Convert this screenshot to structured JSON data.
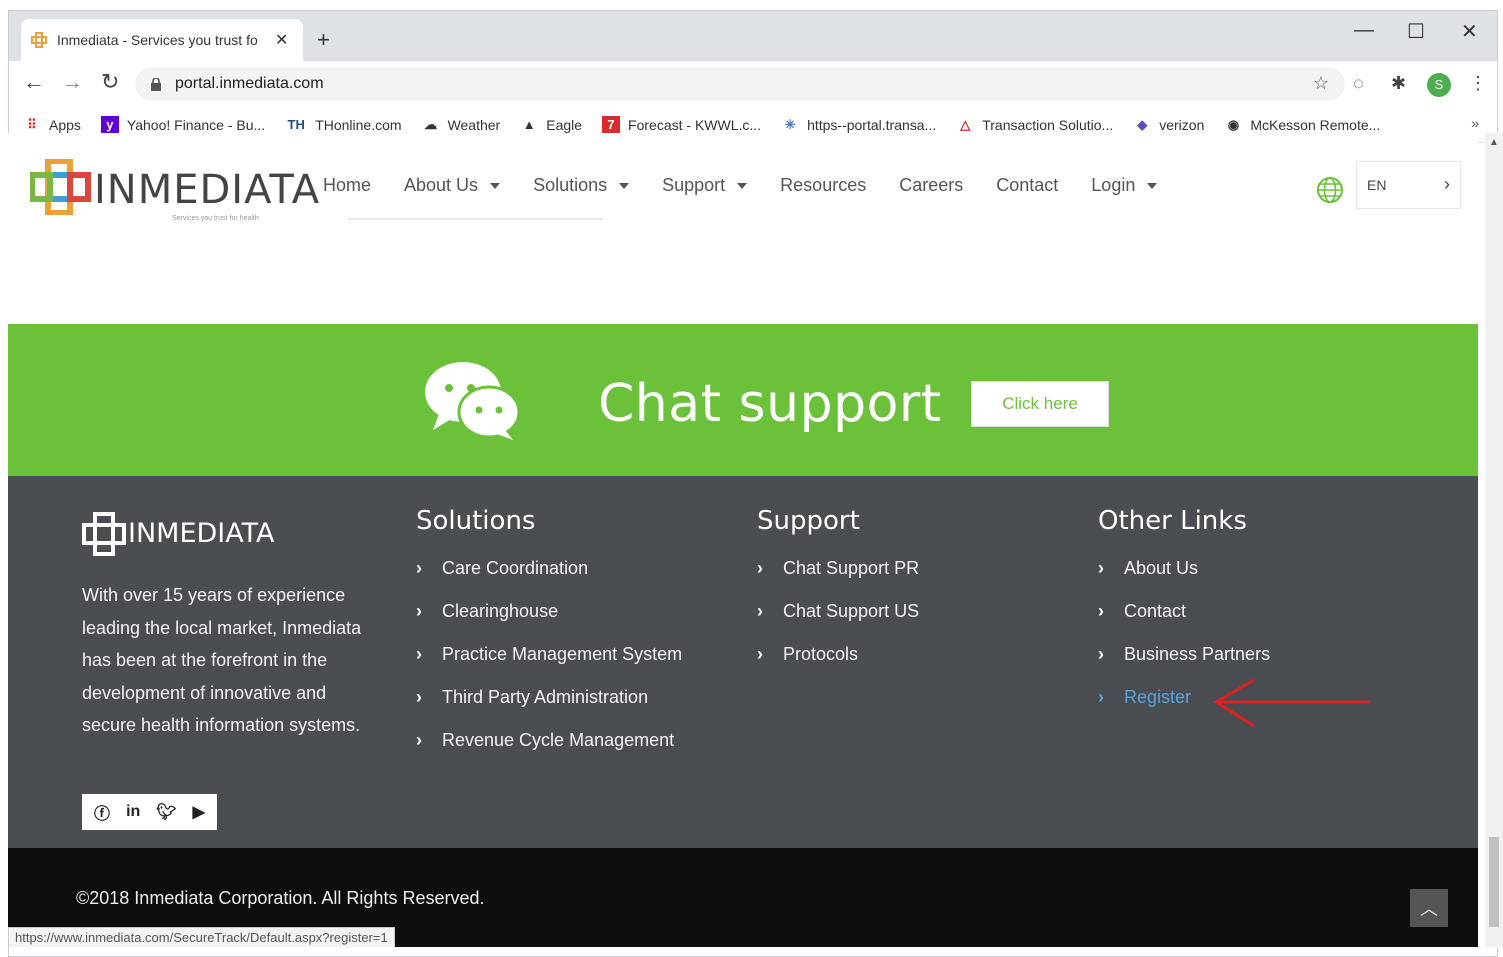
{
  "browser": {
    "tab_title": "Inmediata - Services you trust fo",
    "url": "portal.inmediata.com",
    "status_url": "https://www.inmediata.com/SecureTrack/Default.aspx?register=1",
    "profile_initial": "S",
    "bookmarks": [
      {
        "label": "Apps",
        "icon": "apps-grid-icon"
      },
      {
        "label": "Yahoo! Finance - Bu...",
        "icon": "yahoo-icon"
      },
      {
        "label": "THonline.com",
        "icon": "th-icon"
      },
      {
        "label": "Weather",
        "icon": "weather-icon"
      },
      {
        "label": "Eagle",
        "icon": "eagle-icon"
      },
      {
        "label": "Forecast - KWWL.c...",
        "icon": "forecast-icon"
      },
      {
        "label": "https--portal.transa...",
        "icon": "portal-icon"
      },
      {
        "label": "Transaction Solutio...",
        "icon": "transaction-icon"
      },
      {
        "label": "verizon",
        "icon": "verizon-icon"
      },
      {
        "label": "McKesson Remote...",
        "icon": "mckesson-icon"
      }
    ]
  },
  "header": {
    "logo_text": "INMEDIATA",
    "logo_tagline": "Services you trust for health",
    "nav": [
      {
        "label": "Home",
        "dropdown": false
      },
      {
        "label": "About Us",
        "dropdown": true
      },
      {
        "label": "Solutions",
        "dropdown": true
      },
      {
        "label": "Support",
        "dropdown": true
      },
      {
        "label": "Resources",
        "dropdown": false
      },
      {
        "label": "Careers",
        "dropdown": false
      },
      {
        "label": "Contact",
        "dropdown": false
      },
      {
        "label": "Login",
        "dropdown": true
      }
    ],
    "language": "EN"
  },
  "chat": {
    "title": "Chat support",
    "button": "Click here"
  },
  "footer": {
    "logo_text": "INMEDIATA",
    "about": "With over 15 years of experience leading the local market, Inmediata has been at the forefront in the development of innovative and secure health information systems.",
    "columns": [
      {
        "title": "Solutions",
        "links": [
          "Care Coordination",
          "Clearinghouse",
          "Practice Management System",
          "Third Party Administration",
          "Revenue Cycle Management"
        ]
      },
      {
        "title": "Support",
        "links": [
          "Chat Support PR",
          "Chat Support US",
          "Protocols"
        ]
      },
      {
        "title": "Other Links",
        "links": [
          "About Us",
          "Contact",
          "Business Partners",
          "Register"
        ]
      }
    ],
    "social": [
      "facebook-icon",
      "linkedin-icon",
      "twitter-icon",
      "youtube-icon"
    ],
    "copyright": "©2018 Inmediata Corporation. All Rights Reserved.",
    "colors": {
      "green": "#6cc13a",
      "footer": "#4a4d52",
      "link_active": "#5aa3d8",
      "annotation_arrow": "#e02020"
    }
  }
}
